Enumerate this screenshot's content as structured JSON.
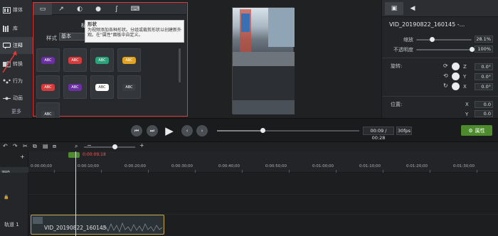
{
  "sidebar": {
    "items": [
      {
        "label": "媒体",
        "icon": "film-icon"
      },
      {
        "label": "库",
        "icon": "library-icon"
      },
      {
        "label": "注释",
        "icon": "annotation-icon",
        "active": true
      },
      {
        "label": "转换",
        "icon": "transition-icon"
      },
      {
        "label": "行为",
        "icon": "behavior-icon"
      },
      {
        "label": "动画",
        "icon": "animation-icon"
      }
    ],
    "more": "更多"
  },
  "annotations": {
    "tabs": [
      {
        "icon": "callout-icon",
        "glyph": "▭"
      },
      {
        "icon": "arrow-icon",
        "glyph": "↗"
      },
      {
        "icon": "shape-icon",
        "glyph": "◐"
      },
      {
        "icon": "blur-icon",
        "glyph": "●"
      },
      {
        "icon": "sketch-icon",
        "glyph": "ʃ"
      },
      {
        "icon": "keystroke-icon",
        "glyph": "⌨"
      }
    ],
    "title_peek": "标",
    "style_label": "样式",
    "style_value": "基本",
    "tooltip": {
      "title": "形状",
      "text": "为视频添加各种形状。分组或裁剪形状以创建新外观。在\"属性\"面板中自定义。"
    },
    "thumbs": [
      {
        "text": "ABC",
        "color": "#6b2fa3"
      },
      {
        "text": "ABC",
        "color": "#d63b3b"
      },
      {
        "text": "ABC",
        "color": "#2aa37a"
      },
      {
        "text": "ABC",
        "color": "#e0a21f"
      },
      {
        "text": "ABC",
        "color": "#d63b3b"
      },
      {
        "text": "ABC",
        "color": "#6b2fa3"
      },
      {
        "text": "ABC",
        "color": "#ffffff"
      },
      {
        "text": "ABC",
        "color": "#3a3d41"
      },
      {
        "text": "ABC",
        "color": "#3a3d41"
      }
    ]
  },
  "properties": {
    "tabs": [
      {
        "icon": "video-properties-icon",
        "glyph": "▣"
      },
      {
        "icon": "audio-icon",
        "glyph": "◀"
      }
    ],
    "clip_title": "VID_20190822_160145 -...",
    "scale_label": "缩放",
    "scale_value": "28.1%",
    "scale_fraction": 0.281,
    "opacity_label": "不透明度",
    "opacity_value": "100%",
    "opacity_fraction": 1.0,
    "rotation_label": "旋转:",
    "rotation": [
      {
        "axis": "Z",
        "value": "0.0°"
      },
      {
        "axis": "Y",
        "value": "0.0°"
      },
      {
        "axis": "X",
        "value": "0.0°"
      }
    ],
    "position_label": "位置:",
    "position": [
      {
        "axis": "X",
        "value": "0.0"
      },
      {
        "axis": "Y",
        "value": "0.0"
      }
    ]
  },
  "playback": {
    "time": "00:09 / 00:28",
    "fps": "30fps",
    "progress": 0.32,
    "properties_button": "属性"
  },
  "timeline": {
    "zoom_fraction": 0.6,
    "playhead_time": "0:00:09;18",
    "ticks": [
      "0:00:00;00",
      "0:00:10;00",
      "0:00:20;00",
      "0:00:30;00",
      "0:00:40;00",
      "0:00:50;00",
      "0:01:00;00",
      "0:01:10;00",
      "0:01:20;00",
      "0:01:30;00"
    ],
    "lane_label": "测验",
    "track_name": "轨道 1",
    "clip_label": "VID_20190822_160145"
  },
  "colors": {
    "accent_green": "#4e8b2f",
    "highlight_red": "#e03a3a",
    "clip_border": "#c8a84a"
  }
}
